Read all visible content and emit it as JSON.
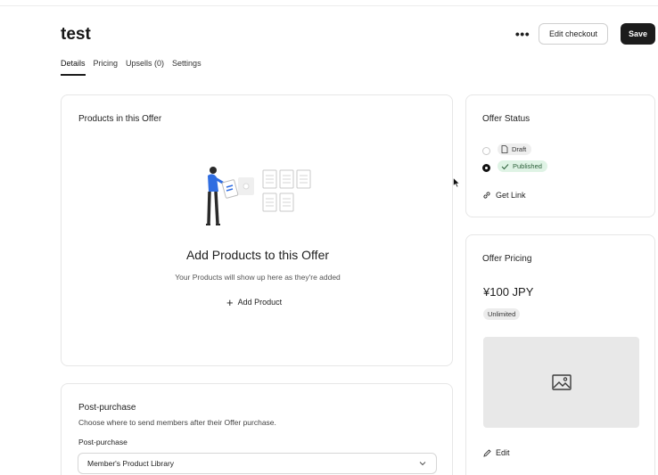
{
  "header": {
    "title": "test",
    "more_icon": "more-horizontal-icon",
    "more_label": "•••",
    "edit_checkout_label": "Edit checkout",
    "save_label": "Save"
  },
  "tabs": [
    {
      "label": "Details",
      "active": true
    },
    {
      "label": "Pricing",
      "active": false
    },
    {
      "label": "Upsells (0)",
      "active": false
    },
    {
      "label": "Settings",
      "active": false
    }
  ],
  "products": {
    "title": "Products in this Offer",
    "empty_title": "Add Products to this Offer",
    "empty_subtitle": "Your Products will show up here as they're added",
    "add_label": "Add Product"
  },
  "post_purchase": {
    "title": "Post-purchase",
    "description": "Choose where to send members after their Offer purchase.",
    "field_label": "Post-purchase",
    "selected": "Member's Product Library"
  },
  "offer_status": {
    "title": "Offer Status",
    "options": [
      {
        "label": "Draft",
        "selected": false,
        "icon": "document-icon"
      },
      {
        "label": "Published",
        "selected": true,
        "icon": "check-icon"
      }
    ],
    "get_link_label": "Get Link"
  },
  "offer_pricing": {
    "title": "Offer Pricing",
    "price": "¥100 JPY",
    "badge": "Unlimited",
    "edit_label": "Edit"
  },
  "colors": {
    "accent_blue": "#2f6de1",
    "published_bg": "#dff3e5",
    "published_text": "#2a5e38",
    "save_bg": "#1c1c1c"
  }
}
